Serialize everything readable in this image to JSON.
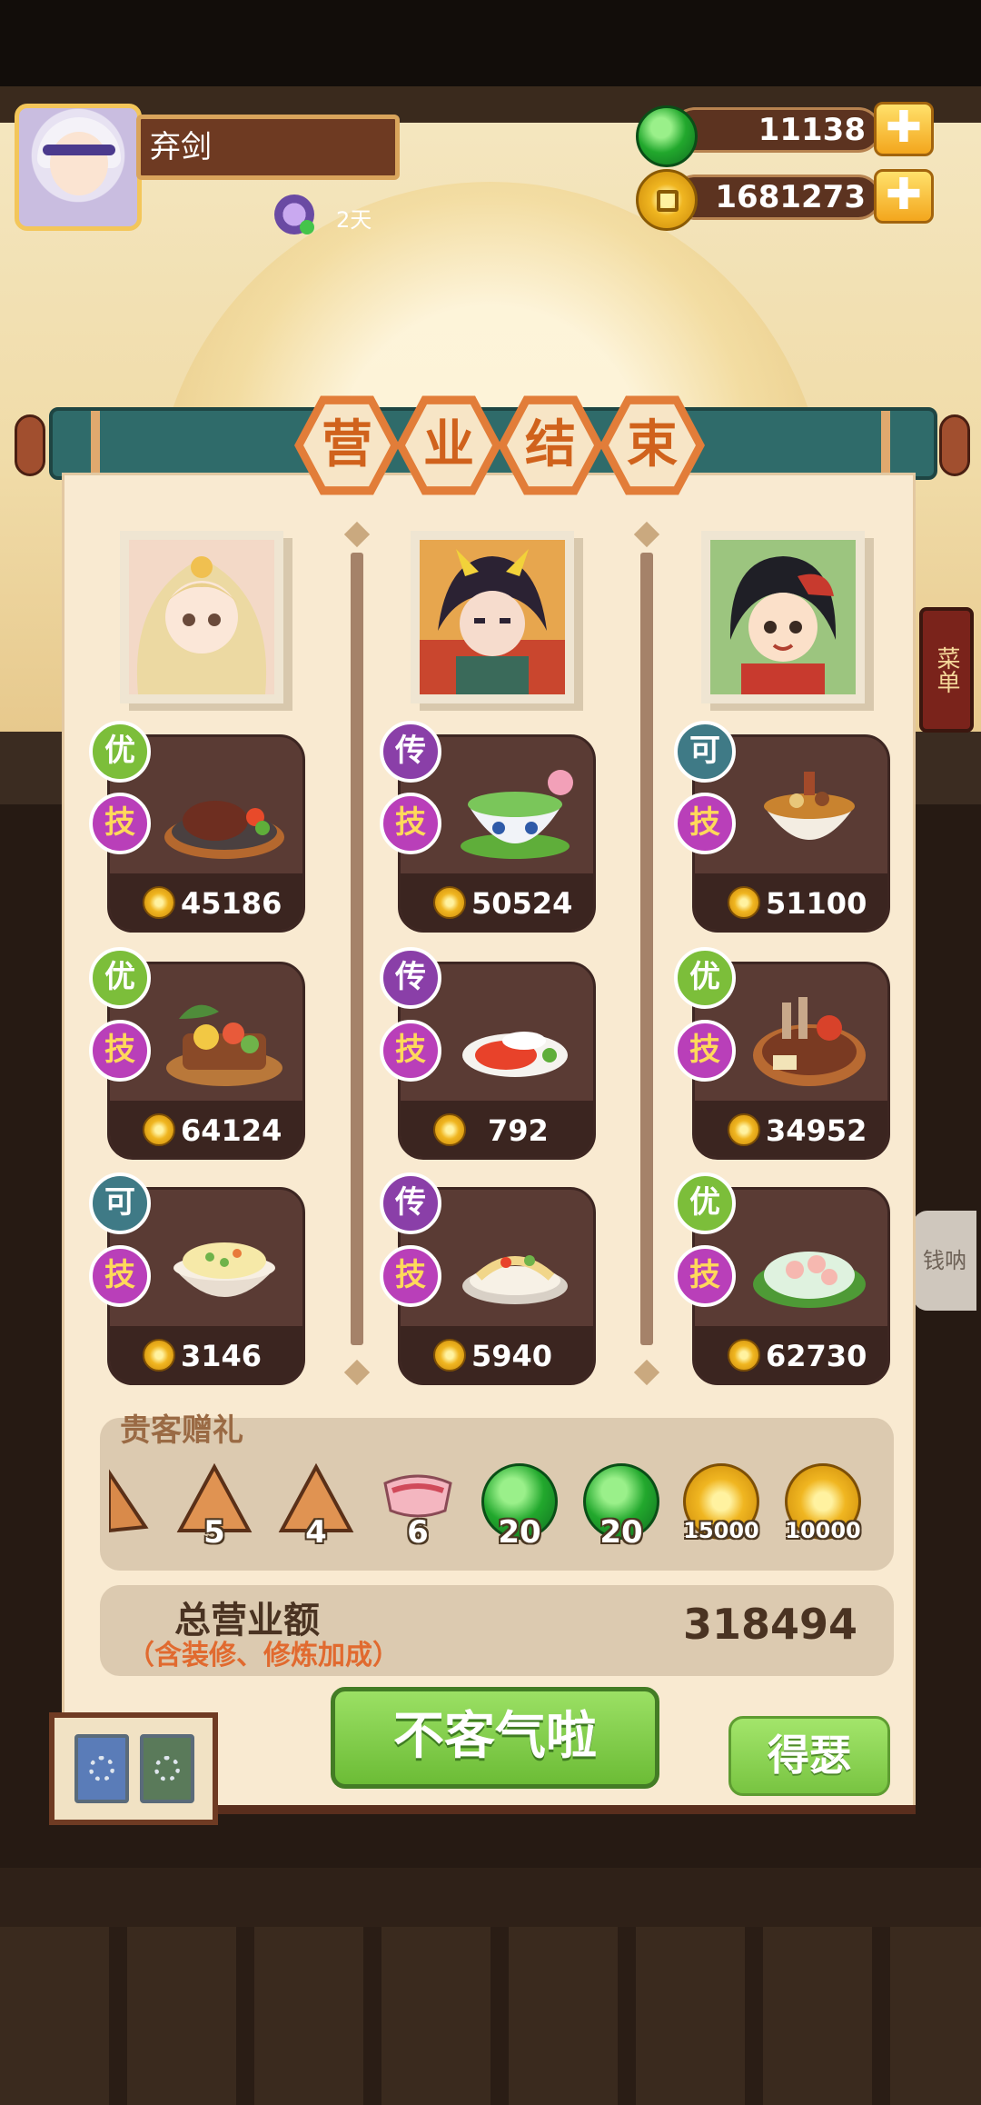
{
  "player": {
    "name": "弃剑",
    "days": "2天"
  },
  "currency": {
    "jade": "11138",
    "coins": "1681273",
    "add_label": "✚"
  },
  "title": [
    "营",
    "业",
    "结",
    "束"
  ],
  "background": {
    "menu_sign": "菜单",
    "side_chip": "钱呐"
  },
  "columns": [
    {
      "guest": "guest-1",
      "dishes": [
        {
          "grade": "优",
          "grade_color": "#7cbe3a",
          "skill": "技",
          "price": "45186",
          "food": "steak"
        },
        {
          "grade": "优",
          "grade_color": "#7cbe3a",
          "skill": "技",
          "price": "64124",
          "food": "banquet"
        },
        {
          "grade": "可",
          "grade_color": "#3f7a86",
          "skill": "技",
          "price": "3146",
          "food": "rice"
        }
      ]
    },
    {
      "guest": "guest-2",
      "dishes": [
        {
          "grade": "传",
          "grade_color": "#8a3fa8",
          "skill": "技",
          "price": "50524",
          "food": "soup"
        },
        {
          "grade": "传",
          "grade_color": "#8a3fa8",
          "skill": "技",
          "price": "792",
          "food": "tomato"
        },
        {
          "grade": "传",
          "grade_color": "#8a3fa8",
          "skill": "技",
          "price": "5940",
          "food": "noodles"
        }
      ]
    },
    {
      "guest": "guest-3",
      "dishes": [
        {
          "grade": "可",
          "grade_color": "#3f7a86",
          "skill": "技",
          "price": "51100",
          "food": "hotpot"
        },
        {
          "grade": "优",
          "grade_color": "#7cbe3a",
          "skill": "技",
          "price": "34952",
          "food": "feast"
        },
        {
          "grade": "优",
          "grade_color": "#7cbe3a",
          "skill": "技",
          "price": "62730",
          "food": "shrimp"
        }
      ]
    }
  ],
  "gifts": {
    "title": "贵客赠礼",
    "items": [
      {
        "icon": "partial-zongzi-icon",
        "count": ""
      },
      {
        "icon": "zongzi-icon",
        "count": "5"
      },
      {
        "icon": "zongzi-icon",
        "count": "4"
      },
      {
        "icon": "meat-icon",
        "count": "6"
      },
      {
        "icon": "jade-icon",
        "count": "20"
      },
      {
        "icon": "jade-icon",
        "count": "20"
      },
      {
        "icon": "coin-icon",
        "count": "15000"
      },
      {
        "icon": "coin-icon",
        "count": "10000"
      }
    ]
  },
  "total": {
    "label": "总营业额",
    "sub": "（含装修、修炼加成）",
    "value": "318494"
  },
  "buttons": {
    "main": "不客气啦",
    "secondary": "得瑟"
  }
}
